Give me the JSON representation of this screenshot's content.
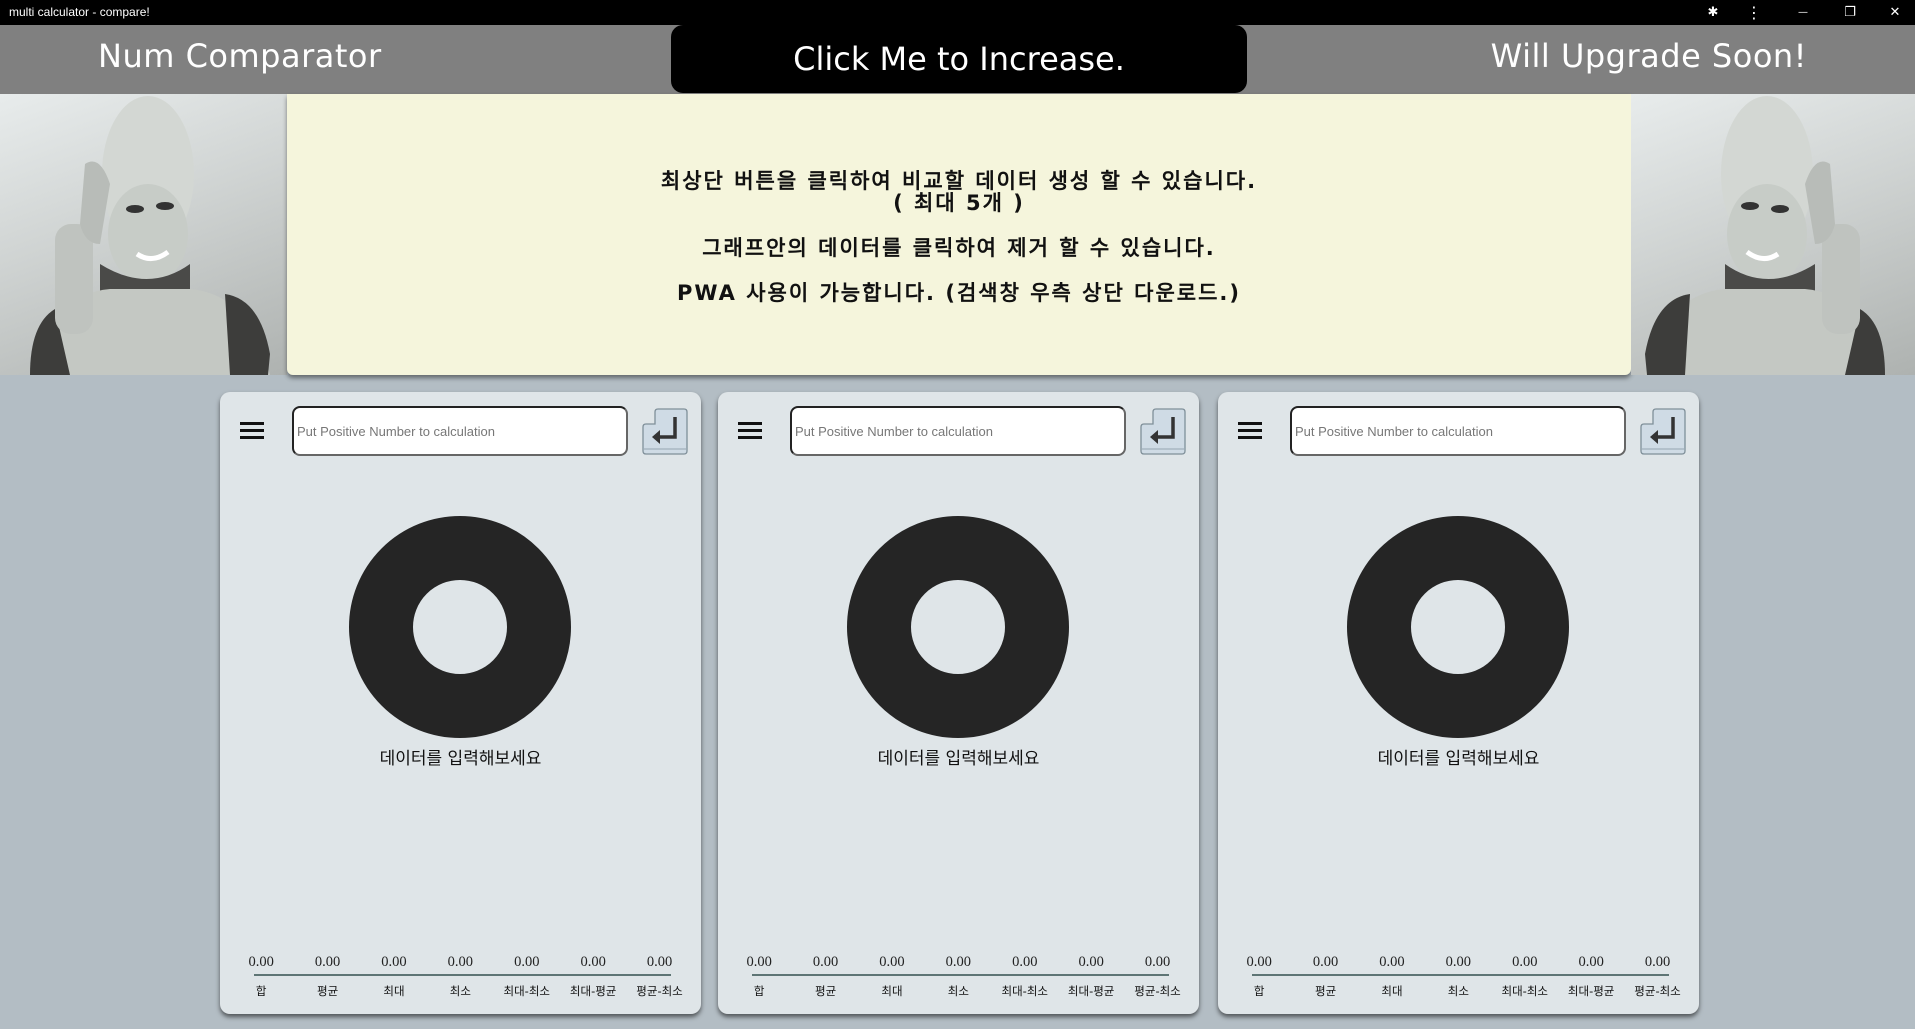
{
  "window": {
    "title": "multi calculator - compare!",
    "controls": [
      {
        "name": "extensions-icon",
        "glyph": "✱"
      },
      {
        "name": "more-menu-icon",
        "glyph": "⋮"
      },
      {
        "name": "minimize-icon",
        "glyph": "—"
      },
      {
        "name": "restore-icon",
        "glyph": "❐"
      },
      {
        "name": "close-icon",
        "glyph": "✕"
      }
    ]
  },
  "header": {
    "left_title": "Num Comparator",
    "center_button": "Click Me to Increase.",
    "right_title": "Will Upgrade Soon!"
  },
  "info": {
    "line1": "최상단 버튼을 클릭하여 비교할 데이터 생성 할 수 있습니다.",
    "line2": "( 최대 5개 )",
    "line3": "그래프안의 데이터를 클릭하여 제거 할 수 있습니다.",
    "line4": "PWA 사용이 가능합니다. (검색창 우측 상단 다운로드.)"
  },
  "colors": {
    "page_bg": "#b3bdc4",
    "header_bg": "#808080",
    "info_bg": "#f5f5dc",
    "card_bg": "#dfe5e8",
    "donut": "#252525"
  },
  "cards": [
    {
      "input_placeholder": "Put Positive Number to calculation",
      "input_value": "",
      "empty_message": "데이터를 입력해보세요",
      "stats": [
        {
          "label": "합",
          "value": "0.00"
        },
        {
          "label": "평균",
          "value": "0.00"
        },
        {
          "label": "최대",
          "value": "0.00"
        },
        {
          "label": "최소",
          "value": "0.00"
        },
        {
          "label": "최대-최소",
          "value": "0.00"
        },
        {
          "label": "최대-평균",
          "value": "0.00"
        },
        {
          "label": "평균-최소",
          "value": "0.00"
        }
      ]
    },
    {
      "input_placeholder": "Put Positive Number to calculation",
      "input_value": "",
      "empty_message": "데이터를 입력해보세요",
      "stats": [
        {
          "label": "합",
          "value": "0.00"
        },
        {
          "label": "평균",
          "value": "0.00"
        },
        {
          "label": "최대",
          "value": "0.00"
        },
        {
          "label": "최소",
          "value": "0.00"
        },
        {
          "label": "최대-최소",
          "value": "0.00"
        },
        {
          "label": "최대-평균",
          "value": "0.00"
        },
        {
          "label": "평균-최소",
          "value": "0.00"
        }
      ]
    },
    {
      "input_placeholder": "Put Positive Number to calculation",
      "input_value": "",
      "empty_message": "데이터를 입력해보세요",
      "stats": [
        {
          "label": "합",
          "value": "0.00"
        },
        {
          "label": "평균",
          "value": "0.00"
        },
        {
          "label": "최대",
          "value": "0.00"
        },
        {
          "label": "최소",
          "value": "0.00"
        },
        {
          "label": "최대-최소",
          "value": "0.00"
        },
        {
          "label": "최대-평균",
          "value": "0.00"
        },
        {
          "label": "평균-최소",
          "value": "0.00"
        }
      ]
    }
  ]
}
